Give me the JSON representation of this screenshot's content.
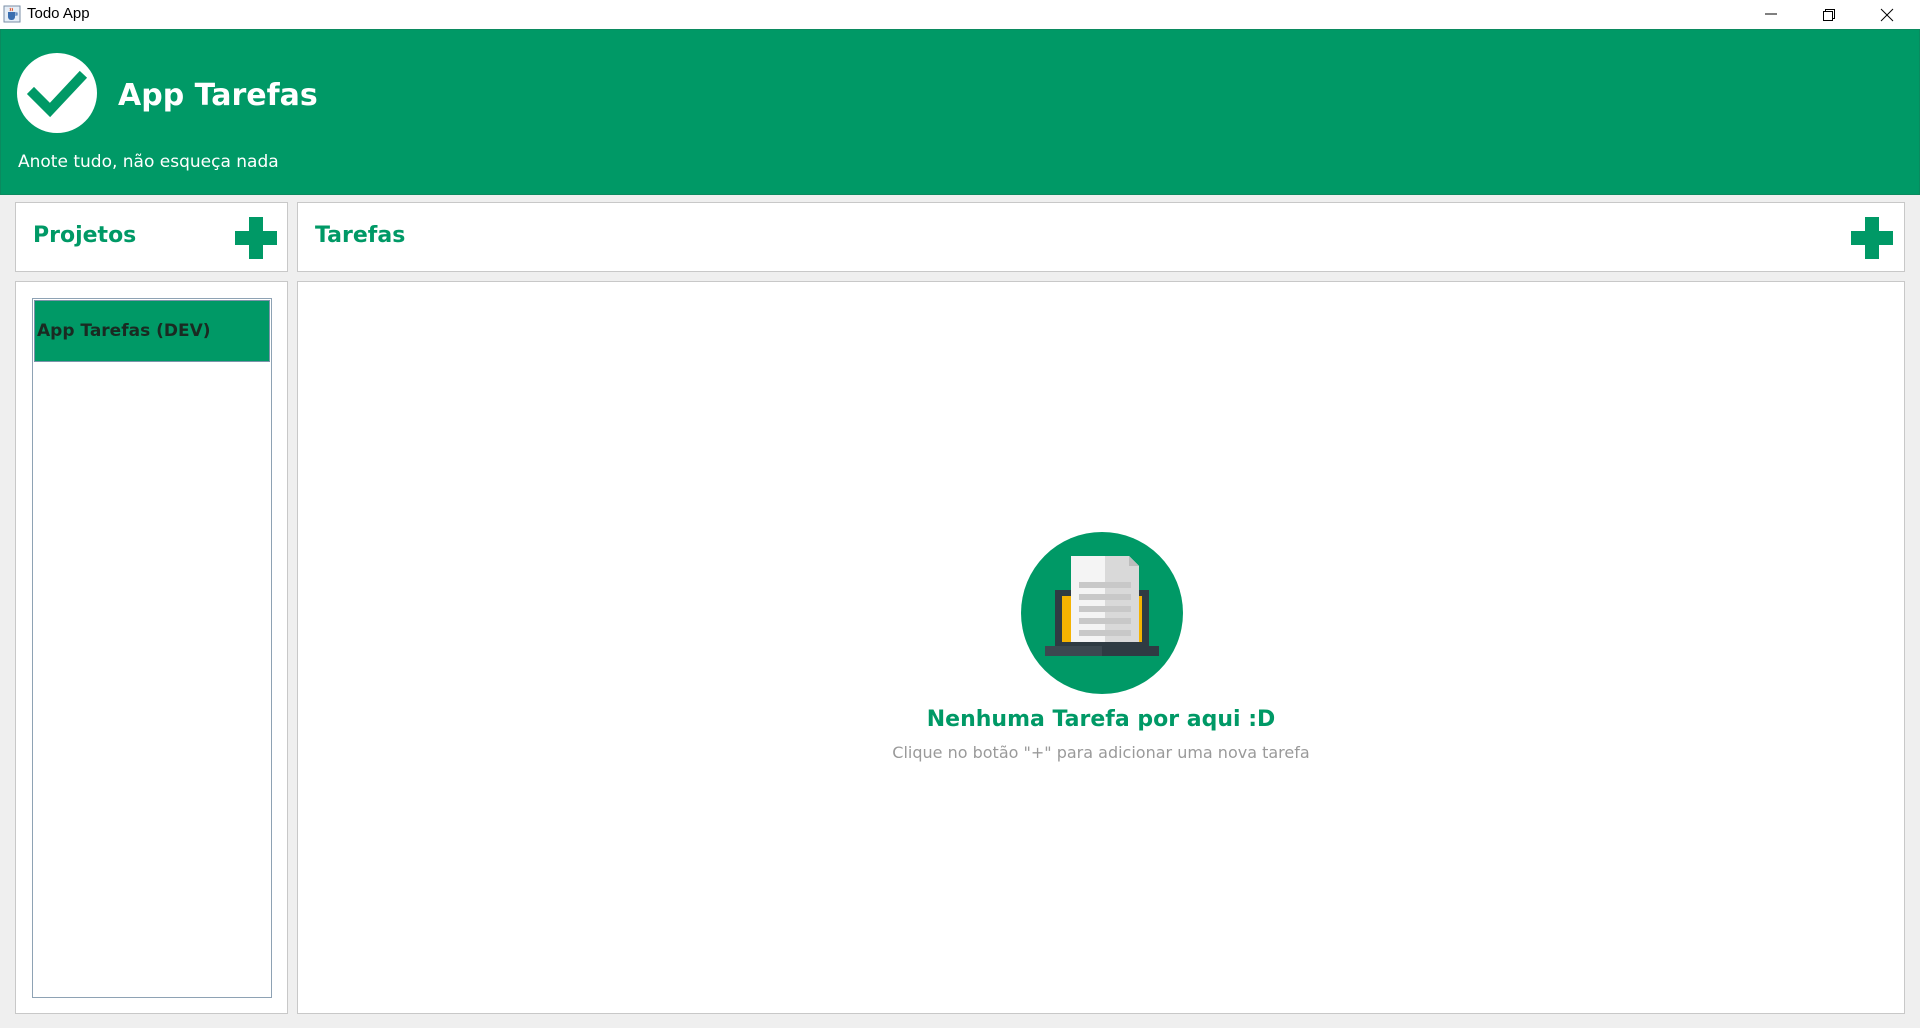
{
  "window": {
    "title": "Todo App",
    "icon": "java-cup-icon"
  },
  "header": {
    "title": "App Tarefas",
    "subtitle": "Anote tudo, não esqueça nada",
    "logo_icon": "checkmark-icon"
  },
  "projects": {
    "title": "Projetos",
    "add_icon": "plus-icon",
    "items": [
      {
        "label": "App Tarefas (DEV)",
        "selected": true
      }
    ]
  },
  "tasks": {
    "title": "Tarefas",
    "add_icon": "plus-icon",
    "empty_title": "Nenhuma Tarefa por aqui :D",
    "empty_subtitle": "Clique no botão \"+\" para adicionar uma nova tarefa",
    "empty_icon": "laptop-document-icon"
  },
  "colors": {
    "accent": "#009966",
    "background": "#efefef",
    "panel": "#ffffff",
    "muted_text": "#9a9a9a"
  }
}
